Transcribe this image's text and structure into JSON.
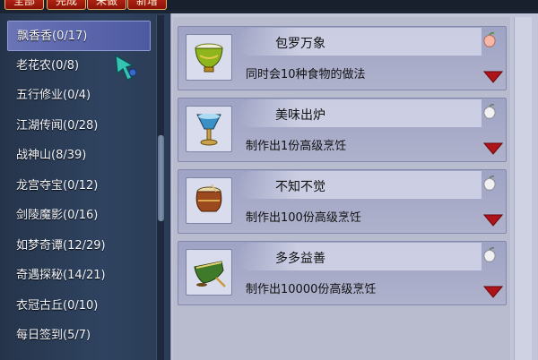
{
  "tabs": [
    {
      "label": "全部"
    },
    {
      "label": "完成"
    },
    {
      "label": "未做"
    },
    {
      "label": "新增"
    }
  ],
  "categories": [
    {
      "label": "飘香香(0/17)",
      "selected": true
    },
    {
      "label": "老花农(0/8)"
    },
    {
      "label": "五行修业(0/4)"
    },
    {
      "label": "江湖传闻(0/28)"
    },
    {
      "label": "战神山(8/39)"
    },
    {
      "label": "龙宫夺宝(0/12)"
    },
    {
      "label": "剑陵魔影(0/16)"
    },
    {
      "label": "如梦奇谭(12/29)"
    },
    {
      "label": "奇遇探秘(14/21)"
    },
    {
      "label": "衣冠古丘(0/10)"
    },
    {
      "label": "每日签到(5/7)"
    }
  ],
  "quests": [
    {
      "title": "包罗万象",
      "desc": "同时会10种食物的做法",
      "icon": "green-bowl-icon",
      "reward_icon": "pink-peach-icon"
    },
    {
      "title": "美味出炉",
      "desc": "制作出1份高级烹饪",
      "icon": "blue-goblet-icon",
      "reward_icon": "white-peach-icon"
    },
    {
      "title": "不知不觉",
      "desc": "制作出100份高级烹饪",
      "icon": "clay-pot-icon",
      "reward_icon": "white-peach-icon"
    },
    {
      "title": "多多益善",
      "desc": "制作出10000份高级烹饪",
      "icon": "green-tea-bowl-icon",
      "reward_icon": "white-peach-icon"
    }
  ],
  "colors": {
    "tab_red": "#a81d10",
    "selected_item": "#5b66ab",
    "card_bg": "#a5a9c7",
    "arrow_red": "#b0141a"
  }
}
